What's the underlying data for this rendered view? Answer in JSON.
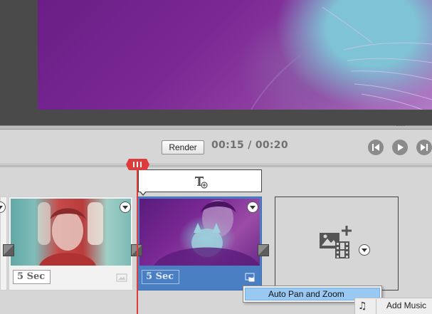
{
  "transport": {
    "render_label": "Render",
    "time_display": "00:15 / 00:20"
  },
  "timeline": {
    "clips": [
      {
        "duration": "5 Sec",
        "selected": false
      },
      {
        "duration": "5 Sec",
        "selected": true
      }
    ]
  },
  "context_menu": {
    "items": [
      "Auto Pan and Zoom"
    ]
  },
  "audio": {
    "add_music_label": "Add Music"
  },
  "colors": {
    "playhead": "#e03a3a",
    "selected_clip": "#4a7fc4",
    "menu_highlight": "#99c9f2"
  },
  "icons": {
    "title": "add-title-icon",
    "add_media": "add-media-icon",
    "music": "music-note-icon"
  }
}
